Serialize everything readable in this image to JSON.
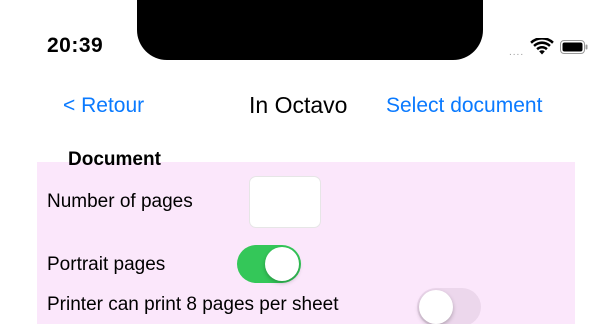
{
  "status_bar": {
    "time": "20:39",
    "signal_dots": "....",
    "wifi_icon": "wifi-icon",
    "battery_icon": "battery-icon"
  },
  "nav": {
    "back_label": "< Retour",
    "title": "In Octavo",
    "action_label": "Select document"
  },
  "colors": {
    "accent": "#0a7aff",
    "section_background": "#fbe7fb",
    "toggle_on": "#34c759",
    "toggle_off": "#ecd7ec"
  },
  "document_section": {
    "header": "Document",
    "number_of_pages": {
      "label": "Number of pages",
      "value": ""
    },
    "portrait_pages": {
      "label": "Portrait pages",
      "on": true
    },
    "printer_8_pages": {
      "label": "Printer can print 8 pages per sheet",
      "on": false
    }
  }
}
